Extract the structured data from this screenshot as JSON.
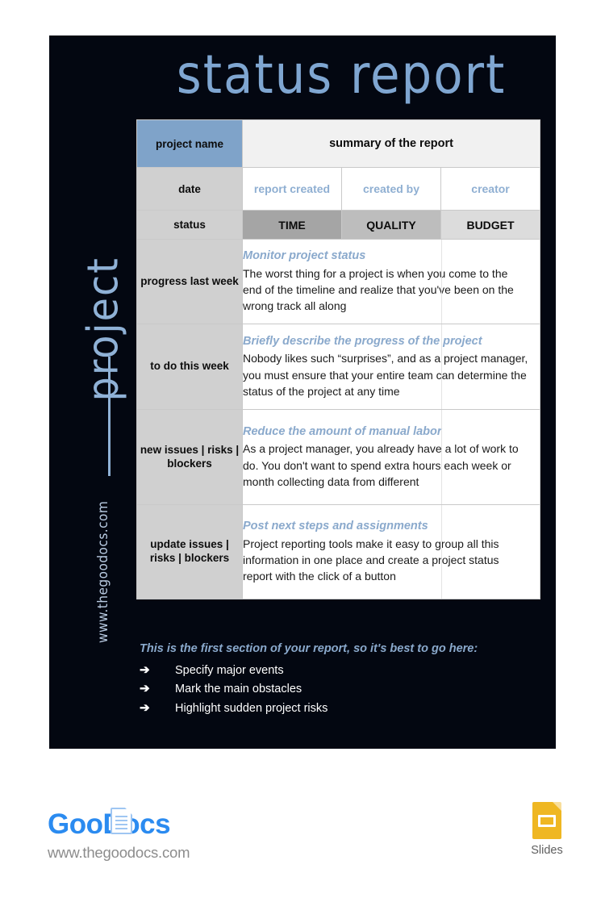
{
  "document": {
    "title": "status report",
    "vertical_word": "project",
    "vertical_url": "www.thegoodocs.com",
    "accent_blue": "#7fa6d1",
    "panel_background": "#030711"
  },
  "table": {
    "header_row_1": {
      "label": "project name",
      "summary": "summary of the report"
    },
    "header_row_2": {
      "label": "date",
      "columns": [
        "report created",
        "created by",
        "creator"
      ]
    },
    "header_row_3": {
      "label": "status",
      "columns": [
        "TIME",
        "QUALITY",
        "BUDGET"
      ],
      "colors": [
        "#a5a5a5",
        "#bdbdbd",
        "#dcdcdc"
      ]
    },
    "rows": [
      {
        "label": "progress last week",
        "subtitle": "Monitor project status",
        "text": "The worst thing for a project is when you come to the end of the timeline and realize that you've been on the wrong track all along"
      },
      {
        "label": "to do this week",
        "subtitle": "Briefly describe the progress of the project",
        "text": "Nobody likes such “surprises”, and as a project manager, you must ensure that your entire team can determine the status of the project at any time"
      },
      {
        "label": "new issues | risks | blockers",
        "subtitle": "Reduce the amount of manual labor",
        "text": "As a project manager, you already have a lot of work to do. You don't want to spend extra hours each week or month collecting data from different"
      },
      {
        "label": "update issues | risks | blockers",
        "subtitle": "Post next steps and assignments",
        "text": "Project reporting tools make it easy to group all this information in one place and create a project status report with the click of a button"
      }
    ]
  },
  "bullets": {
    "heading": "This is the first section of your report, so it's best to go here:",
    "marker": "➔",
    "items": [
      "Specify major events",
      "Mark the main obstacles",
      "Highlight sudden project risks"
    ]
  },
  "footer": {
    "logo_text": "GooDocs",
    "logo_url": "www.thegoodocs.com",
    "slides_label": "Slides",
    "slides_color": "#efb722",
    "logo_color": "#2b8bf0"
  }
}
